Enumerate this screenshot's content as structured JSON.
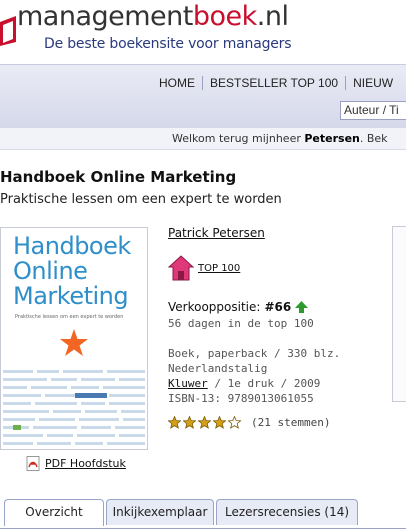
{
  "header": {
    "logo_main": "management",
    "logo_accent": "boek",
    "logo_tld": ".nl",
    "tagline": "De beste boekensite voor managers"
  },
  "nav": {
    "items": [
      "HOME",
      "BESTSELLER TOP 100",
      "NIEUW"
    ],
    "search_placeholder": "Auteur / Ti"
  },
  "welcome": {
    "prefix": "Welkom terug mijnheer ",
    "name": "Petersen",
    "suffix": ".  Bek"
  },
  "book": {
    "title": "Handboek Online Marketing",
    "subtitle": "Praktische lessen om een expert te worden",
    "cover_title_1": "Handboek",
    "cover_title_2": "Online",
    "cover_title_3": "Marketing",
    "cover_sub": "Praktische lessen om een expert te worden",
    "author": "Patrick Petersen",
    "top100_label": "TOP 100",
    "sales_label": "Verkooppositie: ",
    "sales_rank": "#66",
    "days_in_top": "56 dagen in de top 100",
    "format": "Boek, paperback / 330 blz.",
    "language": "Nederlandstalig",
    "publisher": "Kluwer",
    "edition": " / 1e druk / 2009",
    "isbn": "ISBN-13: 9789013061055",
    "rating_text": "(21 stemmen)",
    "rating_value": 4,
    "rating_max": 5,
    "pdf_label": "PDF Hoofdstuk"
  },
  "tabs": [
    "Overzicht",
    "Inkijkexemplaar",
    "Lezersrecensies (14)"
  ],
  "colors": {
    "brand_red": "#c8102e",
    "brand_blue": "#2a3a7c",
    "cover_blue": "#2f8fc9",
    "star_orange": "#f26522",
    "up_green": "#2e9a2e"
  }
}
